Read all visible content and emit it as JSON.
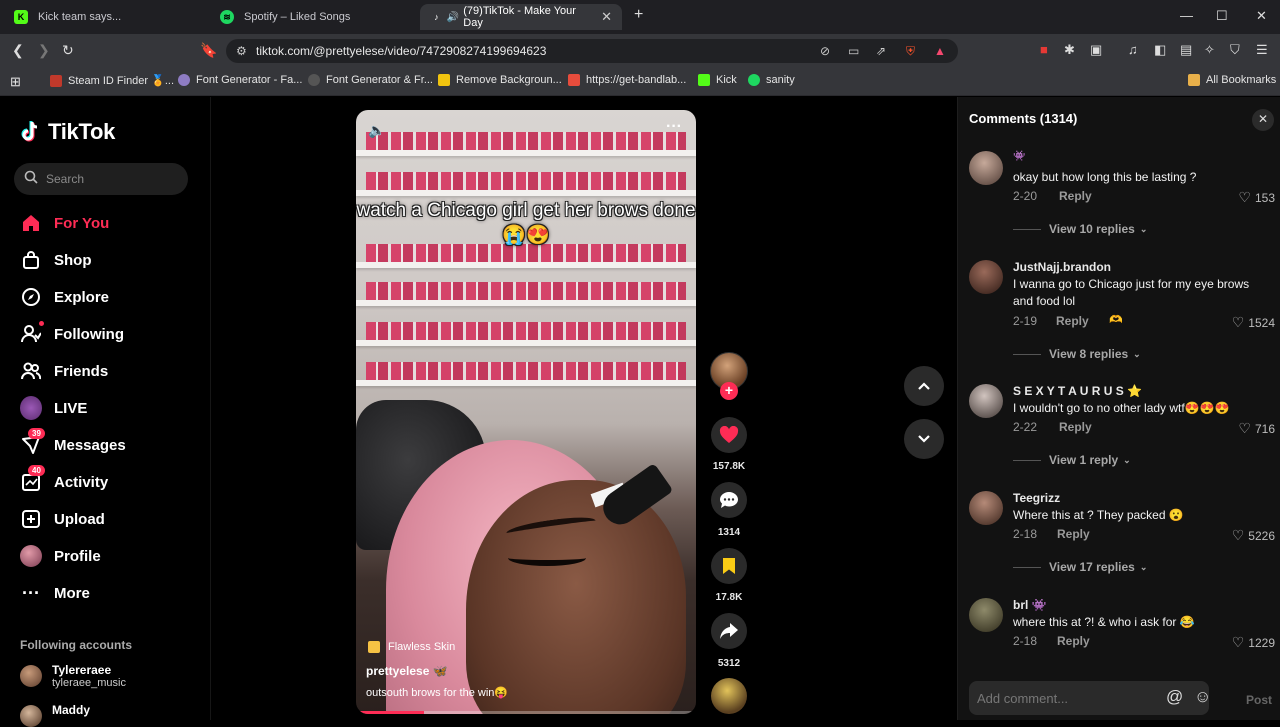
{
  "browser": {
    "tabs": [
      {
        "title": "Kick team says...",
        "icon": "kick-icon",
        "color": "#53fc18"
      },
      {
        "title": "Spotify – Liked Songs",
        "icon": "spotify-icon",
        "color": "#1ed760"
      },
      {
        "title": "(79)TikTok - Make Your Day",
        "icon": "tiktok-icon",
        "color": "#ffffff"
      }
    ],
    "url": "tiktok.com/@prettyelese/video/7472908274199694623",
    "bookmarks": [
      {
        "label": "Steam ID Finder 🏅...",
        "color": "#c0392b"
      },
      {
        "label": "Font Generator - Fa...",
        "color": "#8e7cc3"
      },
      {
        "label": "Font Generator & Fr...",
        "color": "#222222"
      },
      {
        "label": "Remove Backgroun...",
        "color": "#f1c40f"
      },
      {
        "label": "https://get-bandlab...",
        "color": "#e74c3c"
      },
      {
        "label": "Kick",
        "color": "#53fc18"
      },
      {
        "label": "sanity",
        "color": "#1ed760"
      }
    ],
    "all_bookmarks": "All Bookmarks"
  },
  "sidebar": {
    "logo": "TikTok",
    "search_placeholder": "Search",
    "items": [
      {
        "label": "For You",
        "icon": "home-icon",
        "active": true
      },
      {
        "label": "Shop",
        "icon": "shop-icon"
      },
      {
        "label": "Explore",
        "icon": "compass-icon"
      },
      {
        "label": "Following",
        "icon": "following-icon"
      },
      {
        "label": "Friends",
        "icon": "friends-icon"
      },
      {
        "label": "LIVE",
        "icon": "live-icon"
      },
      {
        "label": "Messages",
        "icon": "messages-icon",
        "badge": "39"
      },
      {
        "label": "Activity",
        "icon": "activity-icon",
        "badge": "40"
      },
      {
        "label": "Upload",
        "icon": "upload-icon"
      },
      {
        "label": "Profile",
        "icon": "profile-icon"
      },
      {
        "label": "More",
        "icon": "more-icon"
      }
    ],
    "following_title": "Following accounts",
    "accounts": [
      {
        "name": "Tylereraee",
        "handle": "tyleraee_music"
      },
      {
        "name": "Maddy",
        "handle": ""
      }
    ]
  },
  "video": {
    "caption": "watch a Chicago girl get her brows done😭😍",
    "tag": "Flawless Skin",
    "author": "prettyelese 🦋",
    "description": "outsouth brows for the win😝",
    "progress": 0.2
  },
  "actions": {
    "likes": "157.8K",
    "comments": "1314",
    "saves": "17.8K",
    "shares": "5312"
  },
  "comments_panel": {
    "title": "Comments (1314)",
    "items": [
      {
        "user": "👾",
        "text": "okay but how long this be lasting ?",
        "date": "2-20",
        "reply": "Reply",
        "likes": "153",
        "view": "View 10 replies"
      },
      {
        "user": "JustNajj.brandon",
        "text": "I wanna go to Chicago just for my eye brows and food lol",
        "date": "2-19",
        "reply": "Reply",
        "likes": "1524",
        "view": "View 8 replies"
      },
      {
        "user": "S E X Y T A U R U S ⭐",
        "text": "I wouldn't go to no other lady wtf😍😍😍",
        "date": "2-22",
        "reply": "Reply",
        "likes": "716",
        "view": "View 1 reply"
      },
      {
        "user": "Teegrizz",
        "text": "Where this at ? They packed 😮",
        "date": "2-18",
        "reply": "Reply",
        "likes": "5226",
        "view": "View 17 replies"
      },
      {
        "user": "brl 👾",
        "text": "where this at ?! & who i ask for 😂",
        "date": "2-18",
        "reply": "Reply",
        "likes": "1229",
        "view": ""
      }
    ],
    "add_placeholder": "Add comment...",
    "post_label": "Post"
  }
}
